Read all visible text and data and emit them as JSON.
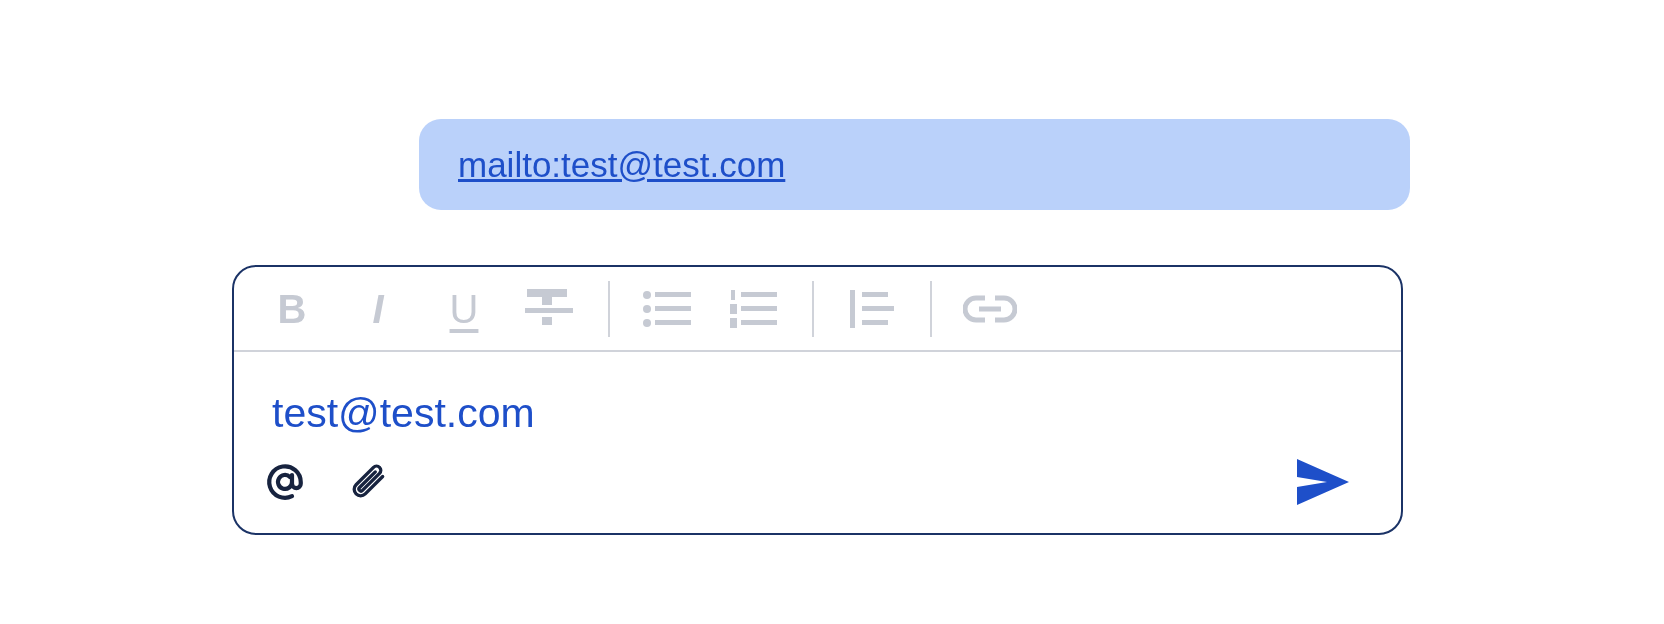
{
  "message": {
    "link": "mailto:test@test.com"
  },
  "composer": {
    "toolbar": [
      {
        "kind": "bold",
        "label": "B",
        "disabled": true
      },
      {
        "kind": "italic",
        "label": "I",
        "disabled": true
      },
      {
        "kind": "underline",
        "label": "U",
        "disabled": true
      },
      {
        "kind": "strike",
        "disabled": true
      },
      {
        "kind": "divider"
      },
      {
        "kind": "bullet-list",
        "disabled": true
      },
      {
        "kind": "numbered-list",
        "disabled": true
      },
      {
        "kind": "divider"
      },
      {
        "kind": "quote",
        "disabled": true
      },
      {
        "kind": "divider"
      },
      {
        "kind": "link",
        "disabled": true
      }
    ],
    "value": "test@test.com"
  }
}
